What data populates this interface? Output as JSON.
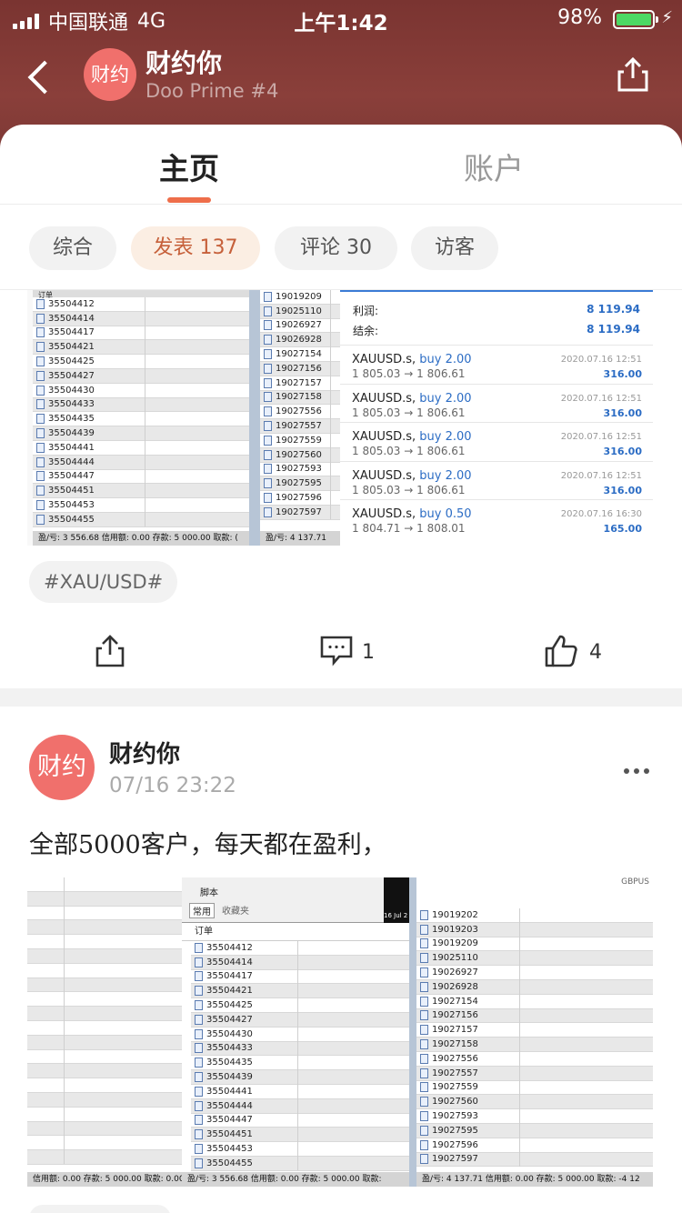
{
  "status_bar": {
    "carrier": "中国联通",
    "network": "4G",
    "time": "上午1:42",
    "battery": "98%",
    "battery_level": 0.98
  },
  "header": {
    "avatar_text": "财约",
    "name": "财约你",
    "subtitle": "Doo Prime #4"
  },
  "tabs": [
    {
      "label": "主页",
      "active": true
    },
    {
      "label": "账户",
      "active": false
    }
  ],
  "filters": [
    {
      "label": "综合"
    },
    {
      "label": "发表 137",
      "active": true
    },
    {
      "label": "评论 30"
    },
    {
      "label": "访客"
    }
  ],
  "post1": {
    "screenshot": {
      "order_header": "订单",
      "orders_left": [
        "35504412",
        "35504414",
        "35504417",
        "35504421",
        "35504425",
        "35504427",
        "35504430",
        "35504433",
        "35504435",
        "35504439",
        "35504441",
        "35504444",
        "35504447",
        "35504451",
        "35504453",
        "35504455"
      ],
      "footer_left": "盈/亏: 3 556.68  信用额: 0.00  存款: 5 000.00  取款: (",
      "orders_mid": [
        "19019209",
        "19025110",
        "19026927",
        "19026928",
        "19027154",
        "19027156",
        "19027157",
        "19027158",
        "19027556",
        "19027557",
        "19027559",
        "19027560",
        "19027593",
        "19027595",
        "19027596",
        "19027597"
      ],
      "footer_mid": "盈/亏: 4 137.71",
      "account": {
        "profit_label": "利润:",
        "profit_value": "8 119.94",
        "balance_label": "结余:",
        "balance_value": "8 119.94"
      },
      "trades": [
        {
          "symbol": "XAUUSD.s,",
          "side": "buy 2.00",
          "price": "1 805.03 → 1 806.61",
          "date": "2020.07.16 12:51",
          "pnl": "316.00"
        },
        {
          "symbol": "XAUUSD.s,",
          "side": "buy 2.00",
          "price": "1 805.03 → 1 806.61",
          "date": "2020.07.16 12:51",
          "pnl": "316.00"
        },
        {
          "symbol": "XAUUSD.s,",
          "side": "buy 2.00",
          "price": "1 805.03 → 1 806.61",
          "date": "2020.07.16 12:51",
          "pnl": "316.00"
        },
        {
          "symbol": "XAUUSD.s,",
          "side": "buy 2.00",
          "price": "1 805.03 → 1 806.61",
          "date": "2020.07.16 12:51",
          "pnl": "316.00"
        },
        {
          "symbol": "XAUUSD.s,",
          "side": "buy 0.50",
          "price": "1 804.71 → 1 808.01",
          "date": "2020.07.16 16:30",
          "pnl": "165.00"
        }
      ]
    },
    "tag": "#XAU/USD#",
    "comments": "1",
    "likes": "4"
  },
  "post2": {
    "avatar_text": "财约",
    "name": "财约你",
    "time": "07/16 23:22",
    "text": "全部5000客户，每天都在盈利，",
    "screenshot": {
      "tab_common": "常用",
      "tab_favorites": "收藏夹",
      "script_label": "脚本",
      "order_header": "订单",
      "orders_mid": [
        "35504412",
        "35504414",
        "35504417",
        "35504421",
        "35504425",
        "35504427",
        "35504430",
        "35504433",
        "35504435",
        "35504439",
        "35504441",
        "35504444",
        "35504447",
        "35504451",
        "35504453",
        "35504455"
      ],
      "footer_left": "信用额: 0.00  存款: 5 000.00  取款: 0.00",
      "footer_mid": "盈/亏: 3 556.68  信用额: 0.00  存款: 5 000.00  取款:",
      "chart_date": "16 Jul 2",
      "symbol": "GBPUS",
      "orders_right": [
        "19019202",
        "19019203",
        "19019209",
        "19025110",
        "19026927",
        "19026928",
        "19027154",
        "19027156",
        "19027157",
        "19027158",
        "19027556",
        "19027557",
        "19027559",
        "19027560",
        "19027593",
        "19027595",
        "19027596",
        "19027597"
      ],
      "footer_right": "盈/亏: 4 137.71  信用额: 0.00  存款: 5 000.00  取款: -4 12"
    }
  }
}
